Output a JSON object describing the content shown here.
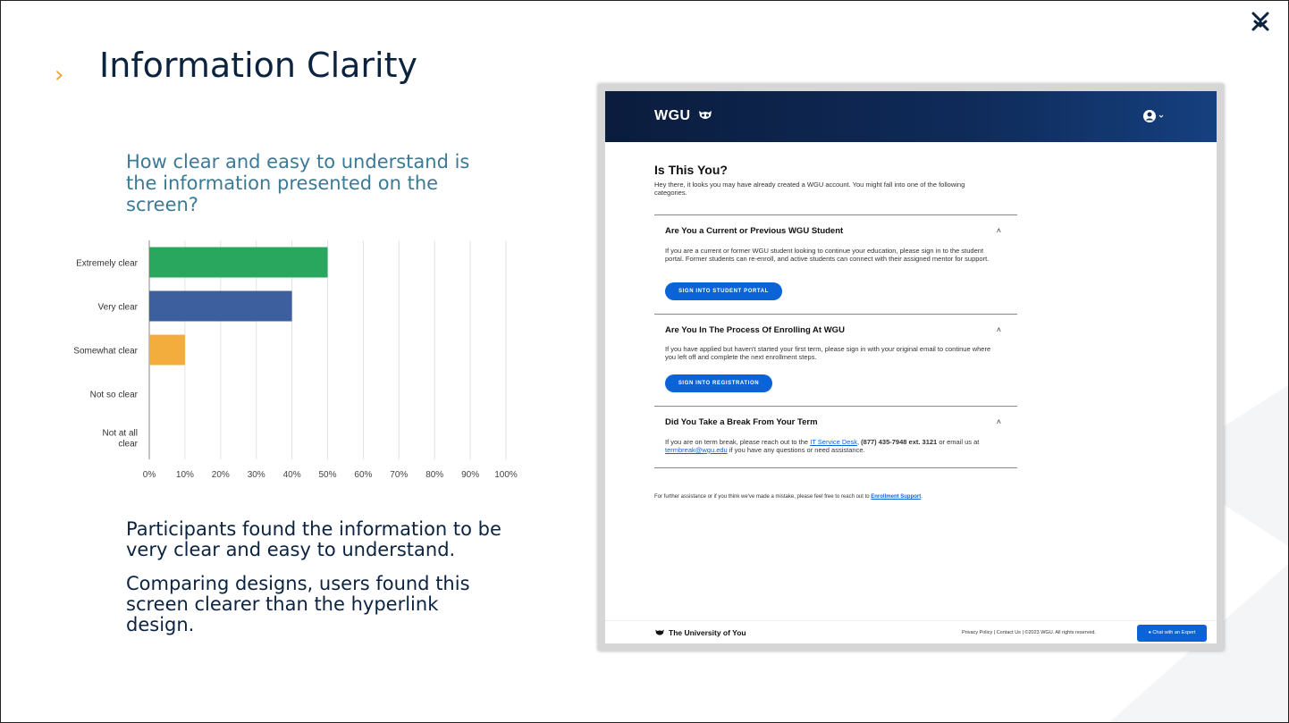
{
  "slide": {
    "title": "Information Clarity",
    "question": "How clear and easy to understand is the information presented on the screen?",
    "takeaways": [
      "Participants found the information to be very clear and easy to understand.",
      "Comparing designs, users found this screen clearer than the hyperlink design."
    ],
    "icons": [
      "chevron-right-icon",
      "company-logo-icon"
    ],
    "colors": {
      "title": "#0c2340",
      "question": "#3b7a96",
      "accent": "#f0a51e"
    }
  },
  "chart_data": {
    "type": "bar",
    "orientation": "horizontal",
    "categories": [
      "Extremely clear",
      "Very clear",
      "Somewhat clear",
      "Not so clear",
      "Not at all clear"
    ],
    "values": [
      50,
      40,
      10,
      0,
      0
    ],
    "colors": [
      "#2aa75e",
      "#3d5f9e",
      "#f2ad3c",
      "#999999",
      "#999999"
    ],
    "xticks": [
      "0%",
      "10%",
      "20%",
      "30%",
      "40%",
      "50%",
      "60%",
      "70%",
      "80%",
      "90%",
      "100%"
    ],
    "xlim": [
      0,
      100
    ],
    "grid": true
  },
  "website": {
    "logo": "WGU",
    "header_icons": [
      "owl-logo-icon",
      "user-account-icon",
      "chevron-down-icon"
    ],
    "heading": "Is This You?",
    "intro": "Hey there, it looks you may have already created a WGU account. You might fall into one of the following categories.",
    "sections": [
      {
        "title": "Are You a Current or Previous WGU Student",
        "body": "If you are a current or former WGU student looking to continue your education, please sign in to the student portal. Former students can re-enroll, and active students can connect with their assigned mentor for support.",
        "button": "SIGN INTO STUDENT PORTAL"
      },
      {
        "title": "Are You In The Process Of Enrolling At WGU",
        "body": "If you have applied but haven't started your first term, please sign in with your original email to continue where you left off and complete the next enrollment steps.",
        "button": "SIGN INTO REGISTRATION"
      },
      {
        "title": "Did You Take a Break From Your Term",
        "body_part1": "If you are on term break, please reach out to the ",
        "link1": "IT Service Desk",
        "body_part2": ", ",
        "phone": "(877) 435-7948 ext. 3121",
        "body_part3": " or email us at ",
        "link2": "termbreak@wgu.edu",
        "body_part4": " if you have any questions or need assistance."
      }
    ],
    "further_text": "For further assistance or if you think we've made a mistake, please feel free to reach out to ",
    "further_link": "Enrollment Support",
    "further_end": ".",
    "footer": {
      "brand": "The University of You",
      "links": "Privacy Policy  |  Contact Us  |  ©2023 WGU. All rights reserved.",
      "chat": "Chat with an Expert"
    }
  }
}
